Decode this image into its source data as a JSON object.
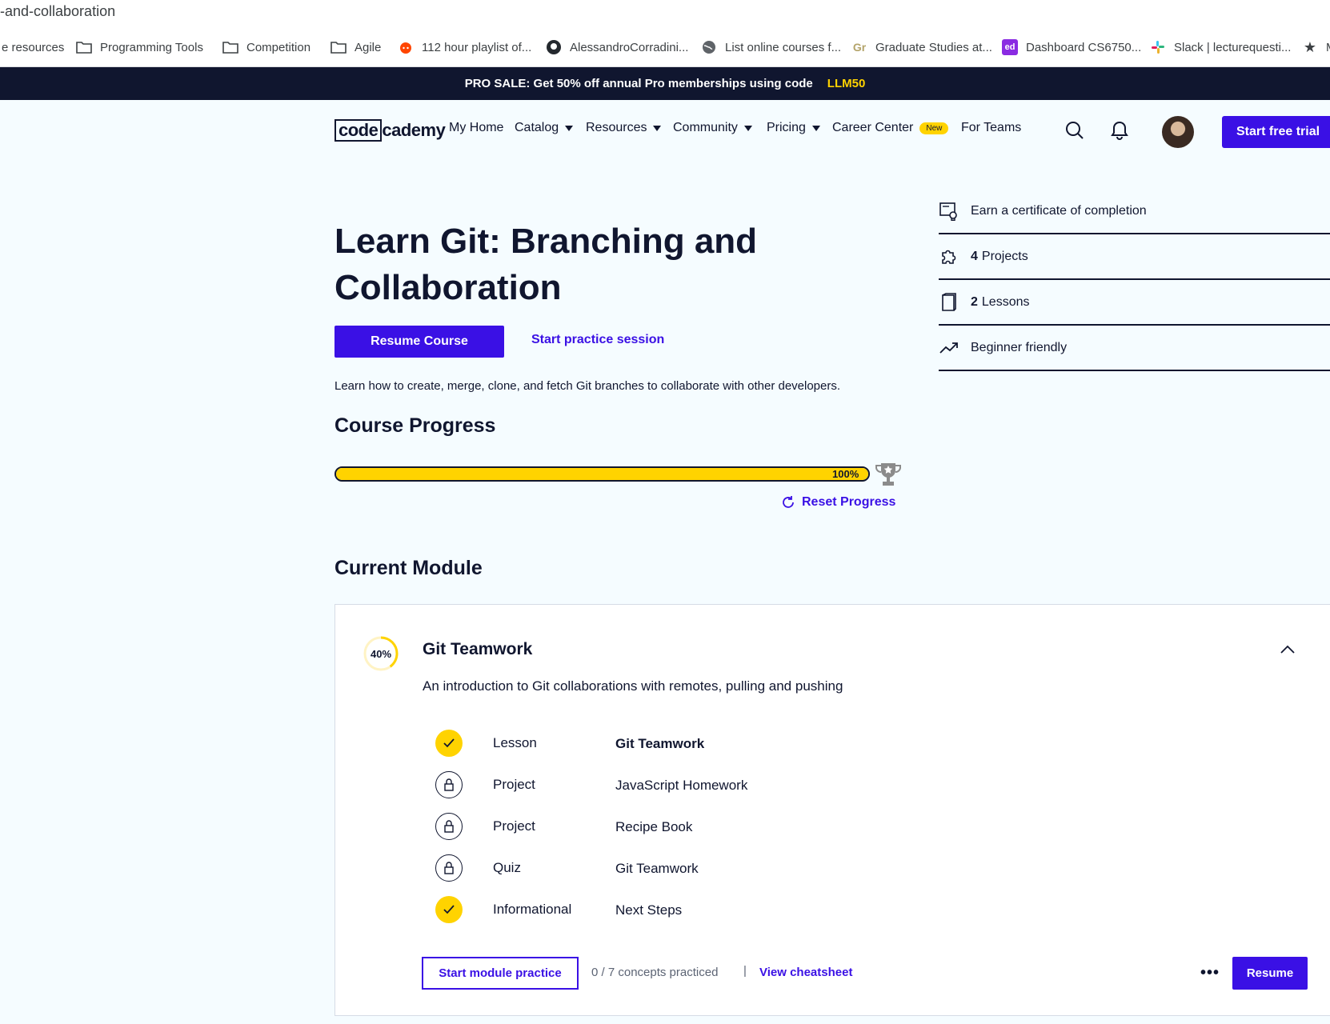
{
  "browser": {
    "url": "-and-collaboration",
    "bookmarks": [
      {
        "label": "e resources",
        "icon": "none"
      },
      {
        "label": "Programming Tools",
        "icon": "folder-icon"
      },
      {
        "label": "Competition",
        "icon": "folder-icon"
      },
      {
        "label": "Agile",
        "icon": "folder-icon"
      },
      {
        "label": "112 hour playlist of...",
        "icon": "reddit-icon"
      },
      {
        "label": "AlessandroCorradini...",
        "icon": "github-icon"
      },
      {
        "label": "List online courses f...",
        "icon": "globe-icon"
      },
      {
        "label": "Graduate Studies at...",
        "icon": "gr-logo-icon"
      },
      {
        "label": "Dashboard CS6750...",
        "icon": "ed-icon"
      },
      {
        "label": "Slack | lecturequesti...",
        "icon": "slack-icon"
      },
      {
        "label": "M",
        "icon": "star-icon"
      }
    ]
  },
  "promo": {
    "text": "PRO SALE: Get 50% off annual Pro memberships using code",
    "code": "LLM50"
  },
  "nav": {
    "logo_left": "code",
    "logo_right": "cademy",
    "links": {
      "my_home": "My Home",
      "catalog": "Catalog",
      "resources": "Resources",
      "community": "Community",
      "pricing": "Pricing",
      "career_center": "Career Center",
      "career_badge": "New",
      "for_teams": "For Teams"
    },
    "start_trial": "Start free trial"
  },
  "course": {
    "title": "Learn Git: Branching and Collaboration",
    "resume_label": "Resume Course",
    "practice_label": "Start practice session",
    "description": "Learn how to create, merge, clone, and fetch Git branches to collaborate with other developers.",
    "progress_heading": "Course Progress",
    "progress_percent": 100,
    "progress_label": "100%",
    "reset_label": "Reset Progress"
  },
  "features": [
    {
      "icon": "certificate-icon",
      "count": "",
      "label": "Earn a certificate of completion"
    },
    {
      "icon": "puzzle-icon",
      "count": "4",
      "label": "Projects"
    },
    {
      "icon": "book-icon",
      "count": "2",
      "label": "Lessons"
    },
    {
      "icon": "trending-up-icon",
      "count": "",
      "label": "Beginner friendly"
    }
  ],
  "module": {
    "heading": "Current Module",
    "progress_percent": 40,
    "progress_label": "40%",
    "title": "Git Teamwork",
    "description": "An introduction to Git collaborations with remotes, pulling and pushing",
    "items": [
      {
        "status": "complete",
        "type": "Lesson",
        "name": "Git Teamwork"
      },
      {
        "status": "locked",
        "type": "Project",
        "name": "JavaScript Homework"
      },
      {
        "status": "locked",
        "type": "Project",
        "name": "Recipe Book"
      },
      {
        "status": "locked",
        "type": "Quiz",
        "name": "Git Teamwork"
      },
      {
        "status": "complete",
        "type": "Informational",
        "name": "Next Steps"
      }
    ],
    "practice_label": "Start module practice",
    "concepts_text": "0 / 7 concepts practiced",
    "separator": "|",
    "cheatsheet_label": "View cheatsheet",
    "more_label": "•••",
    "resume_label": "Resume"
  },
  "colors": {
    "accent": "#3a10e5",
    "yellow": "#ffd300",
    "navy": "#10162f",
    "page_bg": "#f5fcff"
  }
}
